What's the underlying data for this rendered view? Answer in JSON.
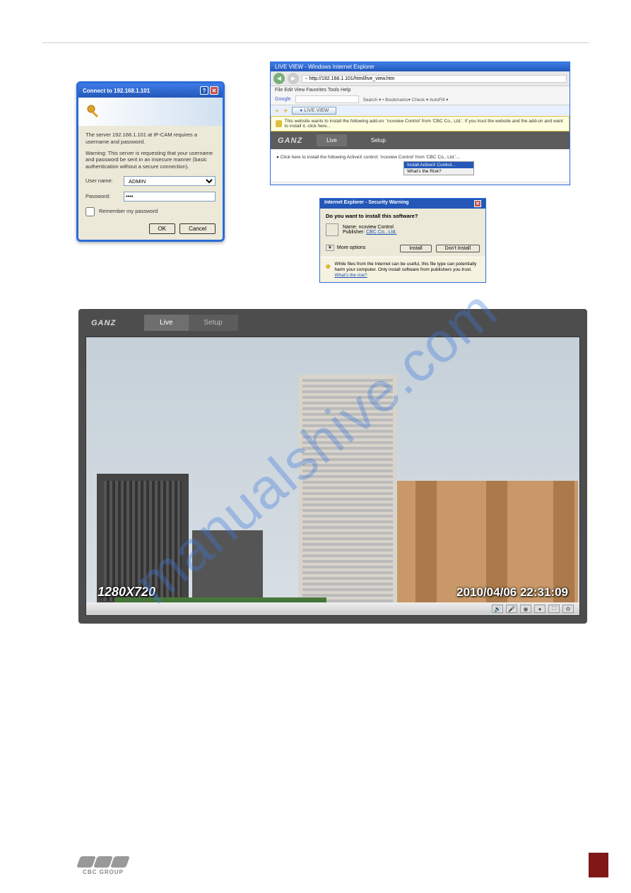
{
  "connect": {
    "title": "Connect to 192.168.1.101",
    "server_text": "The server 192.168.1.101 at IP-CAM requires a username and password.",
    "warning_text": "Warning: This server is requesting that your username and password be sent in an insecure manner (basic authentication without a secure connection).",
    "user_label": "User name:",
    "user_value": "ADMIN",
    "pass_label": "Password:",
    "pass_value": "••••",
    "remember_label": "Remember my password",
    "ok_label": "OK",
    "cancel_label": "Cancel"
  },
  "ie": {
    "window_title": "LIVE VIEW - Windows Internet Explorer",
    "url": "http://192.168.1.101/html/live_view.htm",
    "menu": "File   Edit   View   Favorites   Tools   Help",
    "google_label": "Google",
    "google_items": "Search ▾   •   Bookmarks▾   Check ▾   AutoFill ▾",
    "tab_label": "LIVE VIEW",
    "notice": "This website wants to install the following add-on: 'ncxview Control' from 'CBC Co., Ltd.'. If you trust the website and the add-on and want to install it, click here...",
    "ganz_logo": "GANZ",
    "tabs": {
      "live": "Live",
      "setup": "Setup"
    },
    "activex_click": "● Click here to install the following ActiveX control: 'ncxview Control' from 'CBC Co., Ltd.'...",
    "activex_menu": {
      "install": "Install ActiveX Control...",
      "risk": "What's the Risk?"
    }
  },
  "sec": {
    "title": "Internet Explorer - Security Warning",
    "question": "Do you want to install this software?",
    "name_label": "Name:",
    "name_value": "ncxview Control",
    "pub_label": "Publisher:",
    "pub_value": "CBC Co., Ltd.",
    "more_label": "More options",
    "install_label": "Install",
    "dont_label": "Don't Install",
    "footer_text": "While files from the Internet can be useful, this file type can potentially harm your computer. Only install software from publishers you trust.",
    "risk_link": "What's the risk?"
  },
  "live": {
    "logo": "GANZ",
    "tabs": {
      "live": "Live",
      "setup": "Setup"
    },
    "resolution": "1280X720",
    "timestamp": "2010/04/06 22:31:09"
  },
  "watermark": "manualshive.com",
  "footer": {
    "brand": "CBC GROUP"
  }
}
